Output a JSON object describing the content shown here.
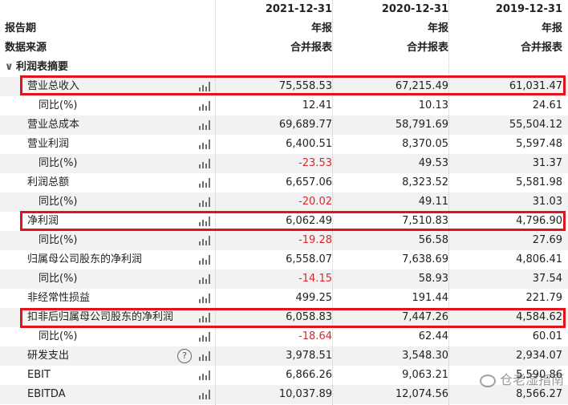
{
  "header": {
    "dates": [
      "2021-12-31",
      "2020-12-31",
      "2019-12-31"
    ],
    "period_label": "报告期",
    "period_values": [
      "年报",
      "年报",
      "年报"
    ],
    "source_label": "数据来源",
    "source_values": [
      "合并报表",
      "合并报表",
      "合并报表"
    ]
  },
  "section": {
    "caret": "∨",
    "title": "利润表摘要"
  },
  "rows": [
    {
      "label": "营业总收入",
      "v": [
        "75,558.53",
        "67,215.49",
        "61,031.47"
      ]
    },
    {
      "label": "同比(%)",
      "v": [
        "12.41",
        "10.13",
        "24.61"
      ]
    },
    {
      "label": "营业总成本",
      "v": [
        "69,689.77",
        "58,791.69",
        "55,504.12"
      ]
    },
    {
      "label": "营业利润",
      "v": [
        "6,400.51",
        "8,370.05",
        "5,597.48"
      ]
    },
    {
      "label": "同比(%)",
      "v": [
        "-23.53",
        "49.53",
        "31.37"
      ]
    },
    {
      "label": "利润总额",
      "v": [
        "6,657.06",
        "8,323.52",
        "5,581.98"
      ]
    },
    {
      "label": "同比(%)",
      "v": [
        "-20.02",
        "49.11",
        "31.03"
      ]
    },
    {
      "label": "净利润",
      "v": [
        "6,062.49",
        "7,510.83",
        "4,796.90"
      ]
    },
    {
      "label": "同比(%)",
      "v": [
        "-19.28",
        "56.58",
        "27.69"
      ]
    },
    {
      "label": "归属母公司股东的净利润",
      "v": [
        "6,558.07",
        "7,638.69",
        "4,806.41"
      ]
    },
    {
      "label": "同比(%)",
      "v": [
        "-14.15",
        "58.93",
        "37.54"
      ]
    },
    {
      "label": "非经常性损益",
      "v": [
        "499.25",
        "191.44",
        "221.79"
      ]
    },
    {
      "label": "扣非后归属母公司股东的净利润",
      "v": [
        "6,058.83",
        "7,447.26",
        "4,584.62"
      ]
    },
    {
      "label": "同比(%)",
      "v": [
        "-18.64",
        "62.44",
        "60.01"
      ]
    },
    {
      "label": "研发支出",
      "help": "?",
      "v": [
        "3,978.51",
        "3,548.30",
        "2,934.07"
      ]
    },
    {
      "label": "EBIT",
      "v": [
        "6,866.26",
        "9,063.21",
        "5,590.86"
      ]
    },
    {
      "label": "EBITDA",
      "v": [
        "10,037.89",
        "12,074.56",
        "8,566.27"
      ]
    }
  ],
  "watermark": "仓老湿指南",
  "colors": {
    "negative": "#e0252b",
    "highlight_box": "#e1141d",
    "shade": "#f2f2f2"
  },
  "icons": {
    "row_chart": "bar-chart-icon",
    "help": "question-circle-icon",
    "watermark": "wechat-icon"
  }
}
